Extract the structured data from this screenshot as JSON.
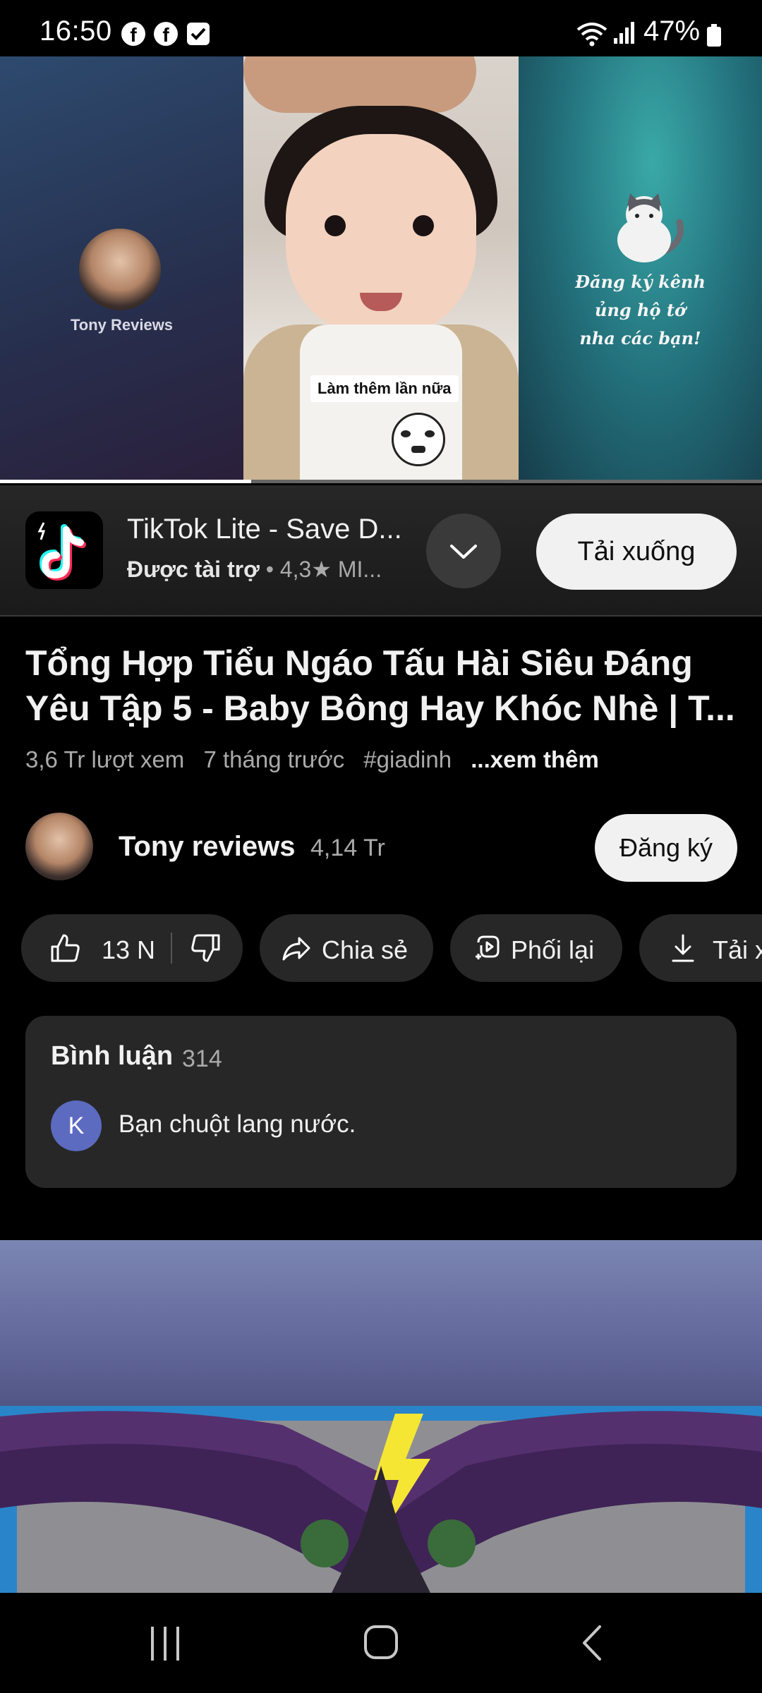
{
  "status_bar": {
    "time": "16:50",
    "notification_icons": [
      "facebook-icon",
      "facebook-icon",
      "check-box-icon"
    ],
    "battery_percent": "47%"
  },
  "player": {
    "left_panel": {
      "channel_label": "Tony Reviews"
    },
    "center_panel": {
      "overlay_caption": "Làm thêm lần nữa"
    },
    "right_panel": {
      "subscribe_message": [
        "Đăng ký kênh",
        "ủng hộ tớ",
        "nha các bạn!"
      ]
    },
    "progress": 0.33
  },
  "ad": {
    "app_name": "TikTok Lite - Save D...",
    "sponsored_label": "Được tài trợ",
    "separator": "•",
    "rating": "4,3★",
    "rating_extra": "MI...",
    "cta_label": "Tải xuống"
  },
  "video": {
    "title": "Tổng Hợp Tiểu Ngáo Tấu Hài Siêu Đáng Yêu Tập 5 - Baby Bông Hay Khóc Nhè | T...",
    "views": "3,6 Tr lượt xem",
    "age": "7 tháng trước",
    "hashtag": "#giadinh",
    "more_label": "...xem thêm"
  },
  "channel": {
    "name": "Tony reviews",
    "subscribers": "4,14 Tr",
    "subscribe_label": "Đăng ký"
  },
  "actions": {
    "like_count": "13 N",
    "share_label": "Chia sẻ",
    "remix_label": "Phối lại",
    "download_label": "Tải x"
  },
  "comments": {
    "title": "Bình luận",
    "count": "314",
    "commenter_initial": "K",
    "top_comment": "Bạn chuột lang nước."
  },
  "colors": {
    "background": "#000000",
    "surface": "#272727",
    "text_primary": "#f1f1f1",
    "text_secondary": "#aaaaaa",
    "avatar_k": "#5c6bc0"
  }
}
